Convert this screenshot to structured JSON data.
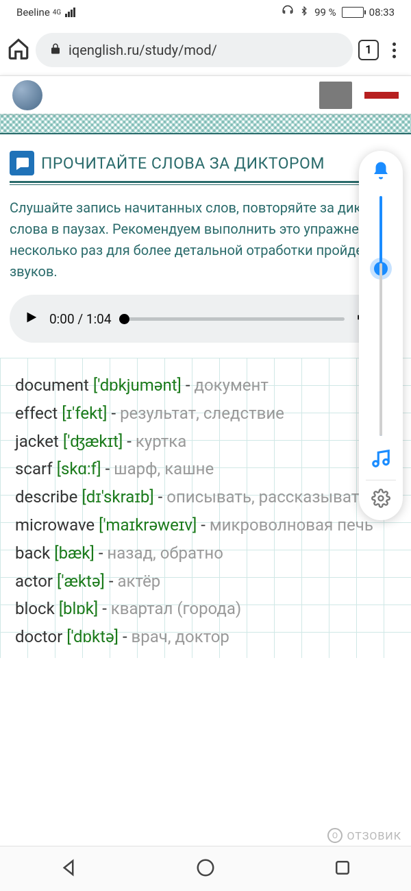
{
  "status": {
    "carrier": "Beeline",
    "net": "4G",
    "battery_pct": "99 %",
    "time": "08:33"
  },
  "browser": {
    "url": "iqenglish.ru/study/mod/",
    "tab_count": "1"
  },
  "section": {
    "title": "ПРОЧИТАЙТЕ СЛОВА ЗА ДИКТОРОМ",
    "instruction": "Слушайте запись начитанных слов, повторяйте за диктором слова в паузах. Рекомендуем выполнить это упражнение несколько раз для более детальной отработки пройденных звуков."
  },
  "audio": {
    "current": "0:00",
    "duration": "1:04"
  },
  "words": [
    {
      "en": "document",
      "tr": "['dɒkjumənt]",
      "ru": "документ"
    },
    {
      "en": "effect",
      "tr": "[ɪ'fekt]",
      "ru": "результат, следствие"
    },
    {
      "en": "jacket",
      "tr": "['ʤækɪt]",
      "ru": "куртка"
    },
    {
      "en": "scarf",
      "tr": "[skɑ:f]",
      "ru": "шарф, кашне"
    },
    {
      "en": "describe",
      "tr": "[dɪ'skraɪb]",
      "ru": "описывать, рассказывать"
    },
    {
      "en": "microwave",
      "tr": "['maɪkrəweɪv]",
      "ru": "микроволновая печь"
    },
    {
      "en": "back",
      "tr": "[bæk]",
      "ru": "назад, обратно"
    },
    {
      "en": "actor",
      "tr": "['æktə]",
      "ru": "актёр"
    },
    {
      "en": "block",
      "tr": "[blɒk]",
      "ru": "квартал (города)"
    },
    {
      "en": "doctor",
      "tr": "['dɒktə]",
      "ru": "врач, доктор"
    }
  ],
  "watermark": "ОТЗОВИК"
}
